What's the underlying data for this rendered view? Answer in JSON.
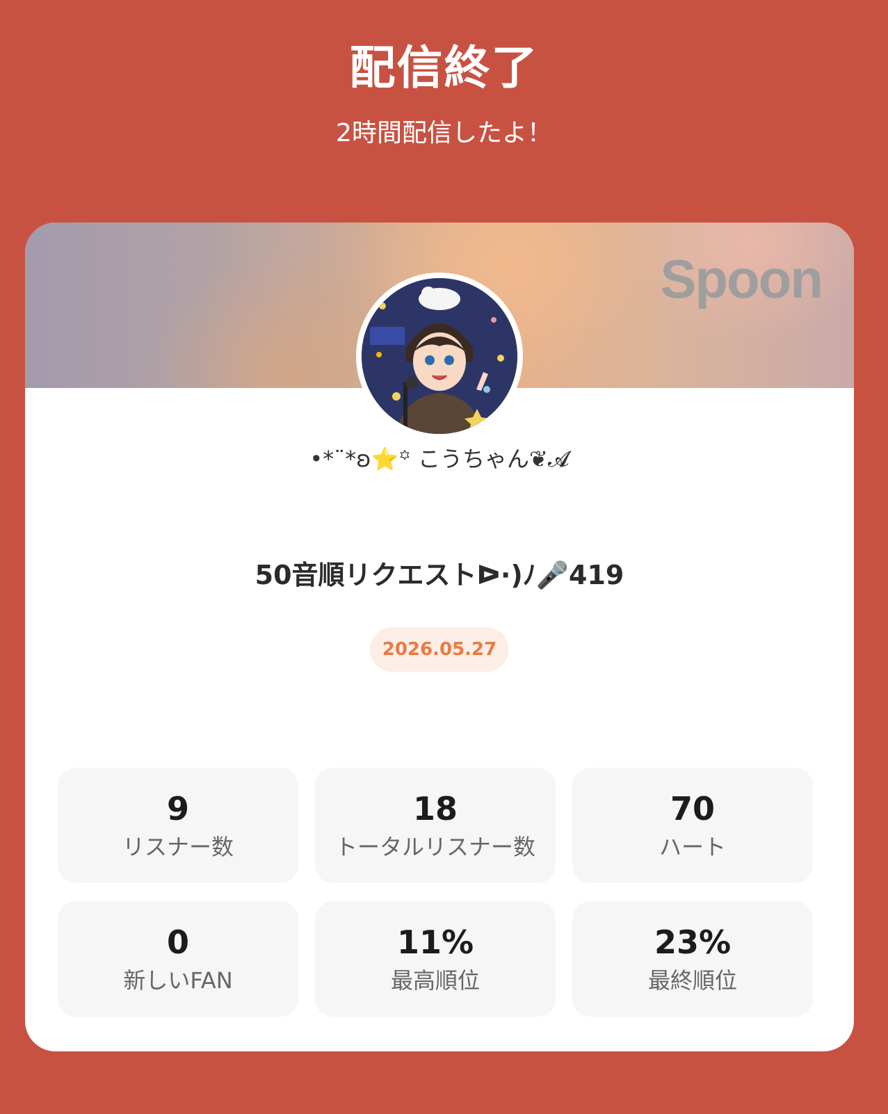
{
  "header": {
    "title": "配信終了",
    "subtitle": "2時間配信したよ！"
  },
  "card": {
    "brand": "Spoon",
    "username": "•*¨*ʚ⭐꙳ こうちゃん❦𝓐",
    "stream_title": "50音順リクエストᐅ·)ﾉ🎤419",
    "date": "2026.05.27"
  },
  "stats": [
    {
      "value": "9",
      "label": "リスナー数"
    },
    {
      "value": "18",
      "label": "トータルリスナー数"
    },
    {
      "value": "70",
      "label": "ハート"
    },
    {
      "value": "0",
      "label": "新しいFAN"
    },
    {
      "value": "11%",
      "label": "最高順位"
    },
    {
      "value": "23%",
      "label": "最終順位"
    }
  ],
  "colors": {
    "background": "#C85242",
    "card": "#FFFFFF",
    "date_text": "#E87B45",
    "date_pill": "#FCEEE6",
    "stat_box": "#F6F6F6"
  }
}
